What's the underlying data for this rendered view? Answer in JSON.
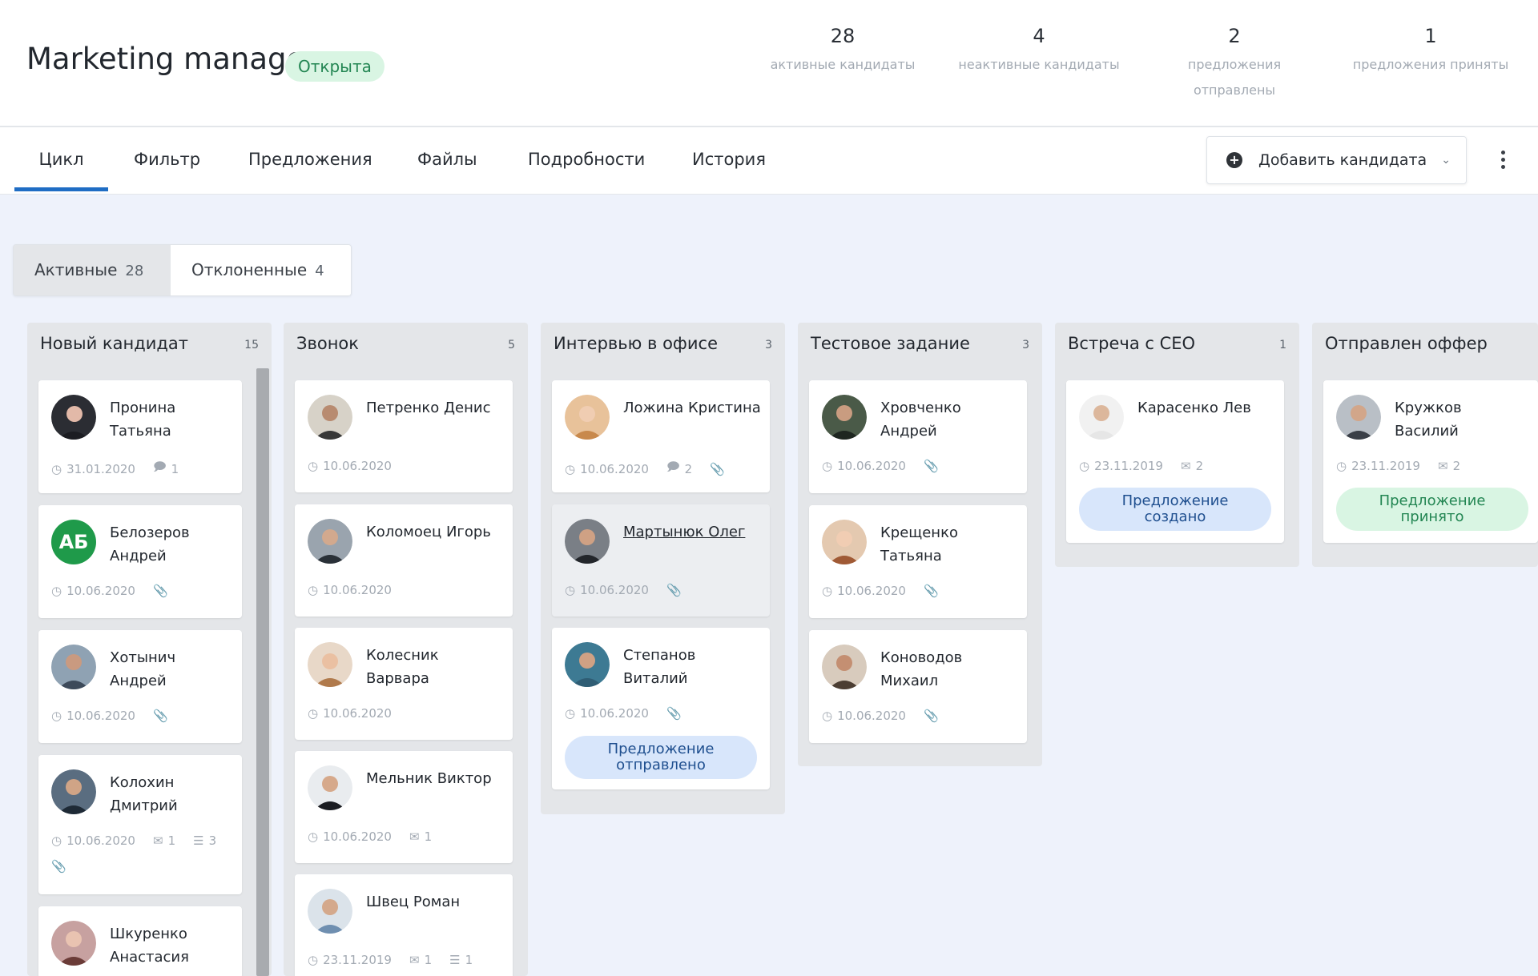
{
  "header": {
    "title": "Marketing manager",
    "status": "Открыта",
    "stats": [
      {
        "value": "28",
        "label": "активные кандидаты"
      },
      {
        "value": "4",
        "label": "неактивные кандидаты"
      },
      {
        "value": "2",
        "label_line1": "предложения",
        "label_line2": "отправлены"
      },
      {
        "value": "1",
        "label": "предложения приняты"
      }
    ]
  },
  "nav": {
    "tabs": [
      "Цикл",
      "Фильтр",
      "Предложения",
      "Файлы",
      "Подробности",
      "История"
    ],
    "add_button": "Добавить кандидата"
  },
  "segment": {
    "active_label": "Активные",
    "active_count": "28",
    "rejected_label": "Отклоненные",
    "rejected_count": "4"
  },
  "columns": [
    {
      "title": "Новый кандидат",
      "count": "15",
      "cards": [
        {
          "name": "Пронина Татьяна",
          "date": "31.01.2020",
          "comments": "1"
        },
        {
          "name": "Белозеров Андрей",
          "initials": "АБ",
          "date": "10.06.2020"
        },
        {
          "name": "Хотынич Андрей",
          "date": "10.06.2020"
        },
        {
          "name": "Колохин Дмитрий",
          "date": "10.06.2020",
          "emails": "1",
          "tasks": "3"
        },
        {
          "name": "Шкуренко Анастасия"
        }
      ]
    },
    {
      "title": "Звонок",
      "count": "5",
      "cards": [
        {
          "name": "Петренко Денис",
          "date": "10.06.2020"
        },
        {
          "name": "Коломоец Игорь",
          "date": "10.06.2020"
        },
        {
          "name": "Колесник Варвара",
          "date": "10.06.2020"
        },
        {
          "name": "Мельник Виктор",
          "date": "10.06.2020",
          "emails": "1"
        },
        {
          "name": "Швец Роман",
          "date": "23.11.2019",
          "emails": "1",
          "tasks": "1"
        }
      ]
    },
    {
      "title": "Интервью в офисе",
      "count": "3",
      "cards": [
        {
          "name": "Ложина Кристина",
          "date": "10.06.2020",
          "comments": "2"
        },
        {
          "name": "Мартынюк Олег",
          "date": "10.06.2020"
        },
        {
          "name": "Степанов Виталий",
          "date": "10.06.2020",
          "badge": "Предложение отправлено"
        }
      ]
    },
    {
      "title": "Тестовое задание",
      "count": "3",
      "cards": [
        {
          "name": "Хровченко Андрей",
          "date": "10.06.2020"
        },
        {
          "name": "Крещенко Татьяна",
          "date": "10.06.2020"
        },
        {
          "name": "Коноводов Михаил",
          "date": "10.06.2020"
        }
      ]
    },
    {
      "title": "Встреча с CEO",
      "count": "1",
      "cards": [
        {
          "name": "Карасенко Лев",
          "date": "23.11.2019",
          "emails": "2",
          "badge_line1": "Предложение",
          "badge_line2": "создано"
        }
      ]
    },
    {
      "title": "Отправлен оффер",
      "cards": [
        {
          "name": "Кружков Василий",
          "date": "23.11.2019",
          "emails": "2",
          "badge_line1": "Предложение",
          "badge_line2": "принято"
        }
      ]
    }
  ],
  "extra": {
    "badge_sent_line1": "Предложение",
    "badge_sent_line2": "отправлено"
  },
  "colors": {
    "accent": "#1f6dc4",
    "status_green": "#238653",
    "badge_blue_bg": "#d8e6fb",
    "badge_green_bg": "#d9f5e3",
    "board_bg": "#eef2fb",
    "column_bg": "#e4e6e9"
  },
  "icons": [
    "clock-icon",
    "comment-icon",
    "paperclip-icon",
    "email-icon",
    "tasks-icon",
    "plus-circle-icon",
    "chevron-down-icon",
    "more-vertical-icon"
  ]
}
